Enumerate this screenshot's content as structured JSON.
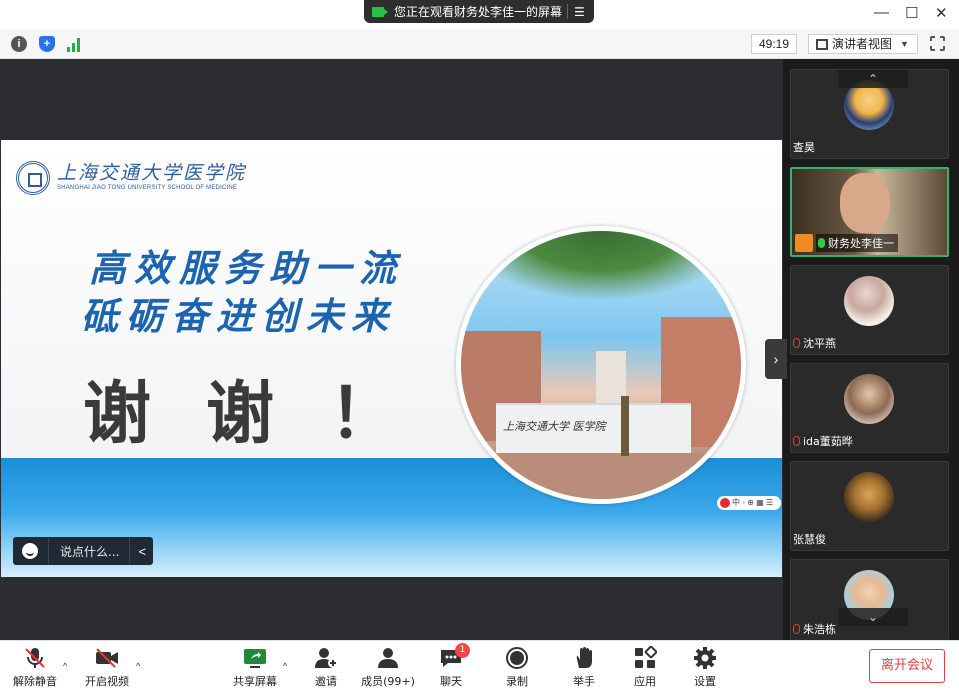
{
  "titlebar": {
    "share_notice": "您正在观看财务处李佳一的屏幕",
    "minimize": "—",
    "maximize": "☐",
    "close": "✕"
  },
  "toolbar": {
    "timer": "49:19",
    "view_label": "演讲者视图"
  },
  "slide": {
    "logo_cn": "上海交通大学医学院",
    "logo_en": "SHANGHAI JIAO TONG UNIVERSITY SCHOOL OF MEDICINE",
    "slogan_line1": "高效服务助一流",
    "slogan_line2": "砥砺奋进创未来",
    "thanks": "谢谢！",
    "photo_sign": "上海交通大学 医学院"
  },
  "comment": {
    "placeholder": "说点什么..."
  },
  "participants": [
    {
      "name": "查昊",
      "state": "avatar"
    },
    {
      "name": "财务处李佳一",
      "state": "video"
    },
    {
      "name": "沈平燕",
      "state": "muted"
    },
    {
      "name": "ida董茹晔",
      "state": "muted"
    },
    {
      "name": "张慧俊",
      "state": "avatar"
    },
    {
      "name": "朱浩栋",
      "state": "muted"
    }
  ],
  "controls": {
    "unmute": "解除静音",
    "start_video": "开启视频",
    "share_screen": "共享屏幕",
    "invite": "邀请",
    "members": "成员(99+)",
    "chat": "聊天",
    "chat_badge": "1",
    "record": "录制",
    "raise_hand": "举手",
    "apps": "应用",
    "settings": "设置",
    "leave": "离开会议"
  },
  "colors": {
    "accent_green": "#23c343",
    "leave_red": "#e34040",
    "slide_blue": "#1c64b0"
  }
}
